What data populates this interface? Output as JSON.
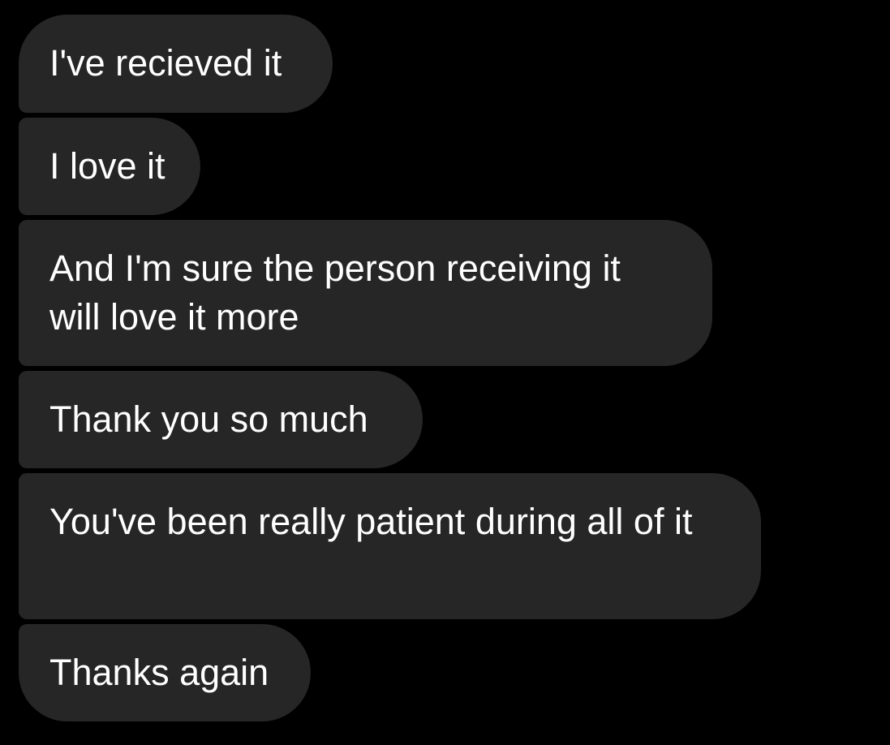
{
  "colors": {
    "background": "#000000",
    "bubble": "#262626",
    "text": "#ffffff"
  },
  "messages": [
    {
      "text": "I've recieved it"
    },
    {
      "text": "I love it"
    },
    {
      "text": "And I'm sure the person receiving it will love it more"
    },
    {
      "text": "Thank you so much"
    },
    {
      "text": "You've been really patient during all of it"
    },
    {
      "text": "Thanks again"
    }
  ]
}
